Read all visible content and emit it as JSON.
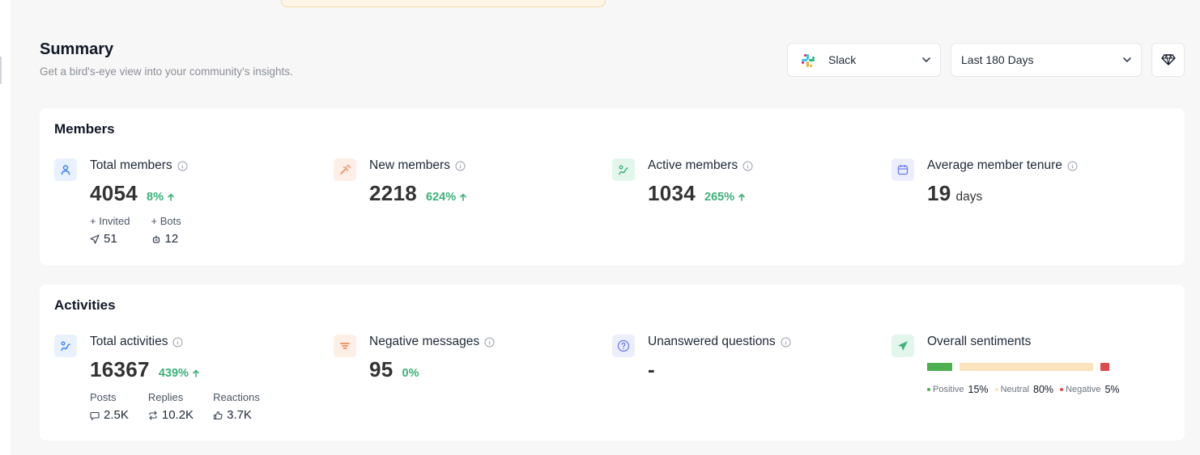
{
  "summary": {
    "title": "Summary",
    "subtitle": "Get a bird's-eye view into your community's insights."
  },
  "filters": {
    "platform": "Slack",
    "range": "Last 180 Days"
  },
  "members": {
    "title": "Members",
    "total": {
      "label": "Total members",
      "value": "4054",
      "change": "8%"
    },
    "invited_label": "+ Invited",
    "invited_value": "51",
    "bots_label": "+ Bots",
    "bots_value": "12",
    "new": {
      "label": "New members",
      "value": "2218",
      "change": "624%"
    },
    "active": {
      "label": "Active members",
      "value": "1034",
      "change": "265%"
    },
    "tenure": {
      "label": "Average member tenure",
      "value": "19",
      "unit": "days"
    }
  },
  "activities": {
    "title": "Activities",
    "total": {
      "label": "Total activities",
      "value": "16367",
      "change": "439%"
    },
    "posts_label": "Posts",
    "posts_value": "2.5K",
    "replies_label": "Replies",
    "replies_value": "10.2K",
    "reactions_label": "Reactions",
    "reactions_value": "3.7K",
    "negative": {
      "label": "Negative messages",
      "value": "95",
      "change": "0%"
    },
    "unanswered": {
      "label": "Unanswered questions",
      "value": "-"
    },
    "sentiment": {
      "label": "Overall sentiments",
      "positive_label": "Positive",
      "positive_value": "15%",
      "positive_share": 0.15,
      "neutral_label": "Neutral",
      "neutral_value": "80%",
      "neutral_share": 0.8,
      "negative_label": "Negative",
      "negative_value": "5%",
      "negative_share": 0.05
    }
  },
  "colors": {
    "positive": "#4caf50",
    "neutral": "#fbe3bd",
    "negative": "#e04a4a",
    "growth": "#3cb179"
  },
  "icons": {
    "total_members": "user-icon",
    "new_members": "magic-wand-icon",
    "active_members": "activity-icon",
    "tenure": "calendar-icon",
    "total_activities": "activity-icon",
    "negative_messages": "filter-lines-icon",
    "unanswered": "question-icon",
    "sentiments": "send-icon"
  }
}
